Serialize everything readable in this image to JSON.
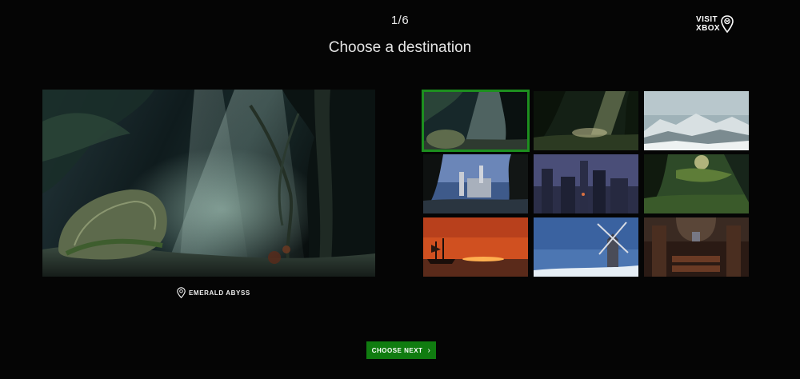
{
  "header": {
    "step_counter": "1/6",
    "title": "Choose a destination",
    "brand": {
      "line1": "VISIT",
      "line2": "XBOX",
      "icon": "map-pin-icon"
    }
  },
  "preview": {
    "location_label": "EMERALD ABYSS",
    "location_icon": "map-pin-icon"
  },
  "destinations": [
    {
      "id": "emerald-abyss",
      "selected": true
    },
    {
      "id": "jungle-light",
      "selected": false
    },
    {
      "id": "snow-peaks",
      "selected": false
    },
    {
      "id": "castle-cliffs",
      "selected": false
    },
    {
      "id": "dark-spires",
      "selected": false
    },
    {
      "id": "forest-ruins",
      "selected": false
    },
    {
      "id": "sunset-sea",
      "selected": false
    },
    {
      "id": "windmill",
      "selected": false
    },
    {
      "id": "cathedral",
      "selected": false
    }
  ],
  "footer": {
    "cta_label": "CHOOSE NEXT",
    "cta_icon": "chevron-right-icon"
  },
  "colors": {
    "accent": "#107c10",
    "selected_border": "#1d8f1f",
    "background": "#050505"
  }
}
